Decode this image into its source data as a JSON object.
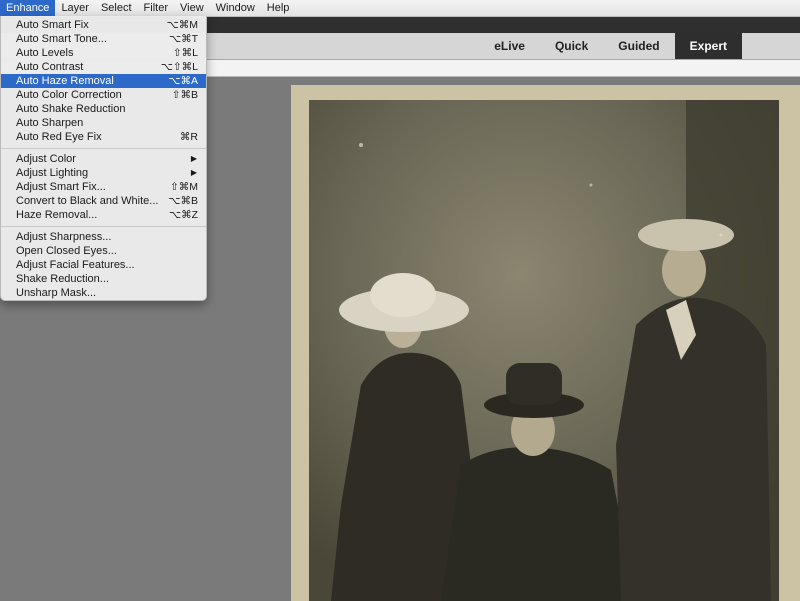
{
  "menubar": {
    "items": [
      "Enhance",
      "Layer",
      "Select",
      "Filter",
      "View",
      "Window",
      "Help"
    ],
    "active": "Enhance"
  },
  "modes": {
    "tabs": [
      "eLive",
      "Quick",
      "Guided",
      "Expert"
    ],
    "active": "Expert"
  },
  "enhance_menu": {
    "group1": [
      {
        "label": "Auto Smart Fix",
        "shortcut": "⌥⌘M"
      },
      {
        "label": "Auto Smart Tone...",
        "shortcut": "⌥⌘T"
      },
      {
        "label": "Auto Levels",
        "shortcut": "⇧⌘L"
      },
      {
        "label": "Auto Contrast",
        "shortcut": "⌥⇧⌘L"
      },
      {
        "label": "Auto Haze Removal",
        "shortcut": "⌥⌘A"
      },
      {
        "label": "Auto Color Correction",
        "shortcut": "⇧⌘B"
      },
      {
        "label": "Auto Shake Reduction",
        "shortcut": ""
      },
      {
        "label": "Auto Sharpen",
        "shortcut": ""
      },
      {
        "label": "Auto Red Eye Fix",
        "shortcut": "⌘R"
      }
    ],
    "group2": [
      {
        "label": "Adjust Color",
        "submenu": "▶"
      },
      {
        "label": "Adjust Lighting",
        "submenu": "▶"
      },
      {
        "label": "Adjust Smart Fix...",
        "shortcut": "⇧⌘M"
      },
      {
        "label": "Convert to Black and White...",
        "shortcut": "⌥⌘B"
      },
      {
        "label": "Haze Removal...",
        "shortcut": "⌥⌘Z"
      }
    ],
    "group3": [
      {
        "label": "Adjust Sharpness..."
      },
      {
        "label": "Open Closed Eyes..."
      },
      {
        "label": "Adjust Facial Features..."
      },
      {
        "label": "Shake Reduction..."
      },
      {
        "label": "Unsharp Mask..."
      }
    ],
    "highlighted": "Auto Haze Removal"
  },
  "colors": {
    "accent": "#2d69c8",
    "canvas": "#7a7a7a",
    "photo_tone": "#c8c0a0"
  }
}
